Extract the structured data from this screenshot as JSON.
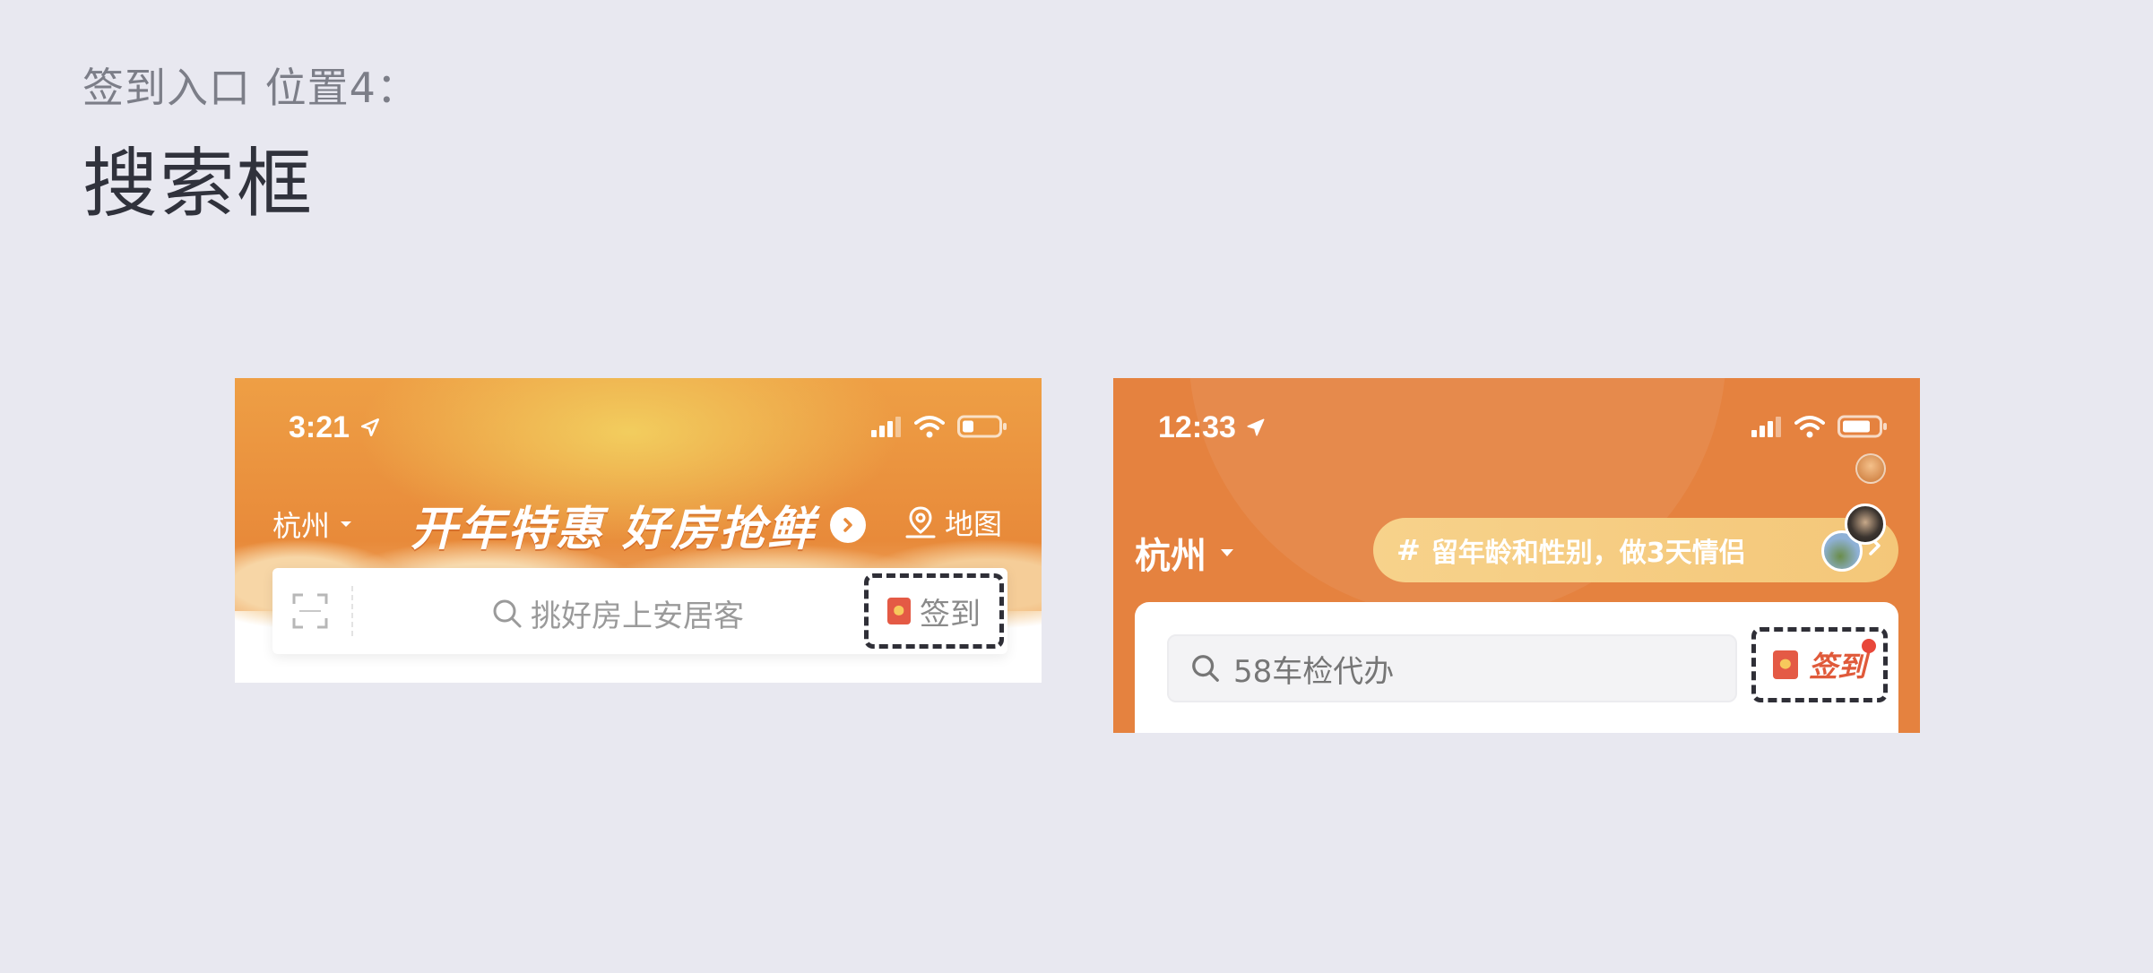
{
  "page": {
    "subtitle": "签到入口 位置4：",
    "title": "搜索框"
  },
  "screen1": {
    "time": "3:21",
    "city": "杭州",
    "banner": "开年特惠 好房抢鲜",
    "map_label": "地图",
    "search_placeholder": "挑好房上安居客",
    "sign_label": "签到"
  },
  "screen2": {
    "time": "12:33",
    "city": "杭州",
    "topic_hash": "#",
    "topic_text": "留年龄和性别，做3天情侣",
    "search_text": "58车检代办",
    "sign_label": "签到"
  },
  "colors": {
    "background": "#e8e8f0",
    "orange": "#e5823f",
    "accent_red": "#e05a3a",
    "dashed_highlight": "#2f2f37"
  },
  "icons": [
    "location-arrow-icon",
    "signal-icon",
    "wifi-icon",
    "battery-icon",
    "dropdown-caret-icon",
    "chevron-right-icon",
    "map-pin-icon",
    "scan-icon",
    "search-icon",
    "red-envelope-icon",
    "notification-dot"
  ]
}
